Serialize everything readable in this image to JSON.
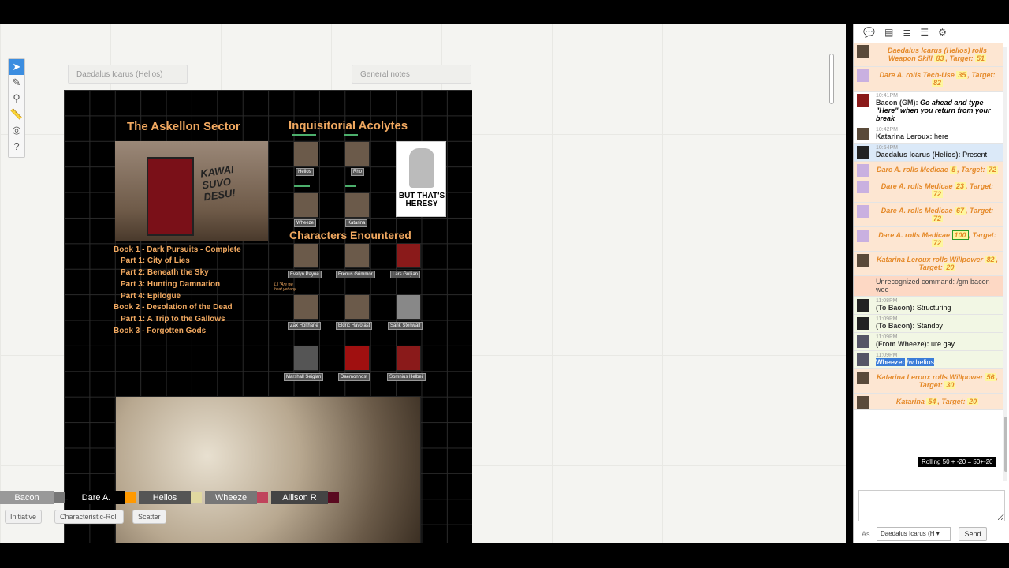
{
  "handouts": {
    "left": "Daedalus Icarus (Helios)",
    "right": "General notes"
  },
  "map": {
    "sector_title": "The Askellon Sector",
    "acolytes_title": "Inquisitorial Acolytes",
    "encountered_title": "Characters Enountered",
    "art_caption": "KAWAI SUVO DESU!",
    "heresy_caption": "BUT THAT'S HERESY",
    "books": [
      "Book 1 - Dark Pursuits - Complete",
      "Part 1: City of Lies",
      "Part 2: Beneath the Sky",
      "Part 3: Hunting Damnation",
      "Part 4: Epilogue",
      "Book 2 - Desolation of the Dead",
      "Part 1: A Trip to the Gallows",
      "Book 3 - Forgotten Gods"
    ],
    "acolytes": [
      "Helios",
      "Rho",
      "Wheeze",
      "Katarina"
    ],
    "encountered": [
      "Evelyn Payne",
      "Frenus Grimmor",
      "Lars Guljian",
      "Zax Holthane",
      "Eldric Havofast",
      "Sank Stenwall",
      "Marshall Seiglan",
      "Daemonhost",
      "Somnius Helbeil"
    ],
    "note": "Lil \"Are we\nbeat yet any"
  },
  "players": [
    {
      "name": "Bacon",
      "color": "#777777",
      "bg": "#999999"
    },
    {
      "name": "Dare A.",
      "color": "#ff9900",
      "bg": "#000000"
    },
    {
      "name": "Helios",
      "color": "#e0d8a0",
      "bg": "#555555"
    },
    {
      "name": "Wheeze",
      "color": "#c0445c",
      "bg": "#777777"
    },
    {
      "name": "Allison R",
      "color": "#5a0a20",
      "bg": "#444444"
    }
  ],
  "macros": [
    "Initiative",
    "Characteristic-Roll",
    "Scatter"
  ],
  "chat": {
    "m1": {
      "text": "Daedalus Icarus (Helios) rolls Weapon Skill",
      "v": "83",
      "t": "51"
    },
    "m2": {
      "text": "Dare A. rolls Tech-Use",
      "v": "35",
      "t": "82"
    },
    "m3": {
      "ts": "10:41PM",
      "who": "Bacon (GM):",
      "text": "Go ahead and type \"Here\" when you return from your break"
    },
    "m4": {
      "ts": "10:42PM",
      "who": "Katarina Leroux:",
      "text": "here"
    },
    "m5": {
      "ts": "10:54PM",
      "who": "Daedalus Icarus (Helios):",
      "text": "Present"
    },
    "m6": {
      "text": "Dare A. rolls Medicae",
      "v": "5",
      "t": "72"
    },
    "m7": {
      "text": "Dare A. rolls Medicae",
      "v": "23",
      "t": "72"
    },
    "m8": {
      "text": "Dare A. rolls Medicae",
      "v": "67",
      "t": "72"
    },
    "m9": {
      "text": "Dare A. rolls Medicae",
      "v": "100",
      "t": "72"
    },
    "m10": {
      "text": "Katarina Leroux rolls Willpower",
      "v": "82",
      "t": "20"
    },
    "m11": {
      "text": "Unrecognized command: /gm bacon woo"
    },
    "m12": {
      "ts": "11:08PM",
      "who": "(To Bacon):",
      "text": "Structuring"
    },
    "m13": {
      "ts": "11:09PM",
      "who": "(To Bacon):",
      "text": "Standby"
    },
    "m14": {
      "ts": "11:09PM",
      "who": "(From Wheeze):",
      "text": "ure gay"
    },
    "m15": {
      "ts": "11:09PM",
      "who": "Wheeze:",
      "text": "/w helios"
    },
    "m16": {
      "text": "Katarina Leroux rolls Willpower",
      "v": "56",
      "t": "30"
    },
    "m17": {
      "text": "Katarina",
      "v": "54",
      "t": "20"
    },
    "target_label": ", Target:"
  },
  "tooltip": "Rolling 50 + -20 = 50+-20",
  "as_label": "As",
  "as_value": "Daedalus Icarus (H",
  "send_label": "Send"
}
